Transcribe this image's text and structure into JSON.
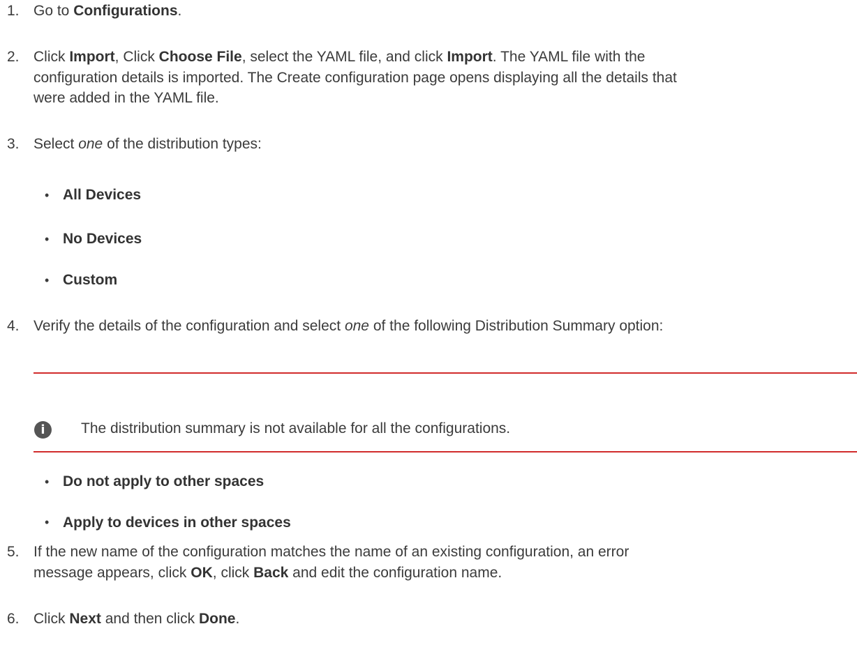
{
  "colors": {
    "text": "#3b3b3b",
    "note_rule": "#d12b2b",
    "note_icon": "#555555"
  },
  "steps": [
    {
      "number": "1.",
      "lines": [
        [
          "Go to ",
          "Configurations",
          "."
        ]
      ]
    },
    {
      "number": "2.",
      "lines": [
        [
          "Click ",
          "Import",
          ", Click ",
          "Choose File",
          ", select the YAML file, and click ",
          "Import",
          ". The YAML file with the"
        ],
        [
          "configuration details is imported. The Create configuration page opens displaying all the details that"
        ],
        [
          "were added in the YAML file."
        ]
      ]
    },
    {
      "number": "3.",
      "lines": [
        [
          "Select ",
          "one",
          " of the distribution types:"
        ]
      ],
      "bullets": [
        "All Devices",
        "No Devices",
        "Custom"
      ]
    },
    {
      "number": "4.",
      "lines": [
        [
          "Verify the details of the configuration and select ",
          "one",
          " of the following Distribution Summary option:"
        ]
      ],
      "note": {
        "icon": "info-icon",
        "text": "The distribution summary is not available for all the configurations."
      },
      "bullets": [
        "Do not apply to other spaces",
        "Apply to devices in other spaces"
      ]
    },
    {
      "number": "5.",
      "lines": [
        [
          "If the new name of the configuration matches the name of an existing configuration, an error"
        ],
        [
          "message appears, click ",
          "OK",
          ", click ",
          "Back",
          " and edit the configuration name."
        ]
      ]
    },
    {
      "number": "6.",
      "lines": [
        [
          "Click ",
          "Next",
          " and then click ",
          "Done",
          "."
        ]
      ]
    }
  ]
}
